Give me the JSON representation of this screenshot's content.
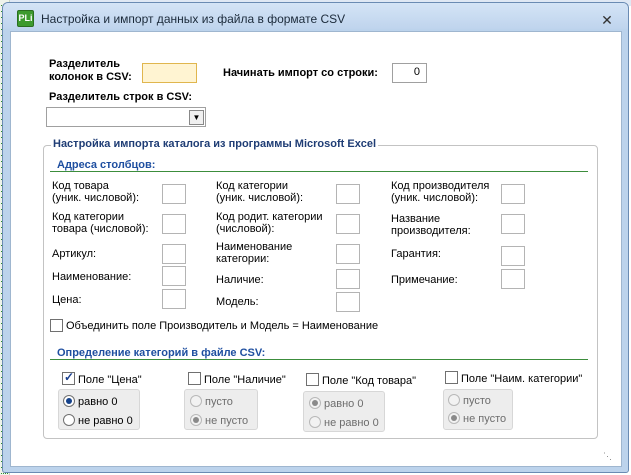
{
  "window": {
    "title": "Настройка и импорт данных из файла в формате CSV",
    "icon_text": "PLi",
    "close_glyph": "✕"
  },
  "top": {
    "col_separator_label_1": "Разделитель",
    "col_separator_label_2": "колонок в CSV:",
    "col_separator_value": "",
    "start_row_label": "Начинать импорт со строки:",
    "start_row_value": "0",
    "row_separator_label": "Разделитель строк в CSV:",
    "row_separator_value": ""
  },
  "excel_group": {
    "title": "Настройка импорта каталога из программы Microsoft Excel",
    "addresses_title": "Адреса столбцов:",
    "col1": {
      "product_code_1": "Код товара",
      "product_code_2": "(уник. числовой):",
      "category_code_1": "Код категории",
      "category_code_2": "товара (числовой):",
      "article": "Артикул:",
      "name": "Наименование:",
      "price": "Цена:"
    },
    "col2": {
      "category_code_1": "Код категории",
      "category_code_2": "(уник. числовой):",
      "parent_category_1": "Код родит. категории",
      "parent_category_2": "(числовой):",
      "category_name_1": "Наименование",
      "category_name_2": "категории:",
      "availability": "Наличие:",
      "model": "Модель:"
    },
    "col3": {
      "manufacturer_code_1": "Код производителя",
      "manufacturer_code_2": "(уник. числовой):",
      "manufacturer_name_1": "Название",
      "manufacturer_name_2": "производителя:",
      "warranty": "Гарантия:",
      "note": "Примечание:"
    },
    "merge_checkbox_label": "Объединить поле Производитель и Модель = Наименование",
    "merge_checked": false,
    "categories_title": "Определение категорий в файле CSV:",
    "fields": [
      {
        "label": "Поле \"Цена\"",
        "checked": true,
        "opt1": "равно 0",
        "opt2": "не равно 0",
        "selected": 1,
        "enabled": true
      },
      {
        "label": "Поле \"Наличие\"",
        "checked": false,
        "opt1": "пусто",
        "opt2": "не пусто",
        "selected": 2,
        "enabled": false
      },
      {
        "label": "Поле \"Код товара\"",
        "checked": false,
        "opt1": "равно 0",
        "opt2": "не равно 0",
        "selected": 1,
        "enabled": false
      },
      {
        "label": "Поле \"Наим. категории\"",
        "checked": false,
        "opt1": "пусто",
        "opt2": "не пусто",
        "selected": 2,
        "enabled": false
      }
    ]
  },
  "colors": {
    "col_separator_highlight": "#fff4d2",
    "section_title": "#1f4fa0",
    "section_line": "#3c8d3c"
  }
}
